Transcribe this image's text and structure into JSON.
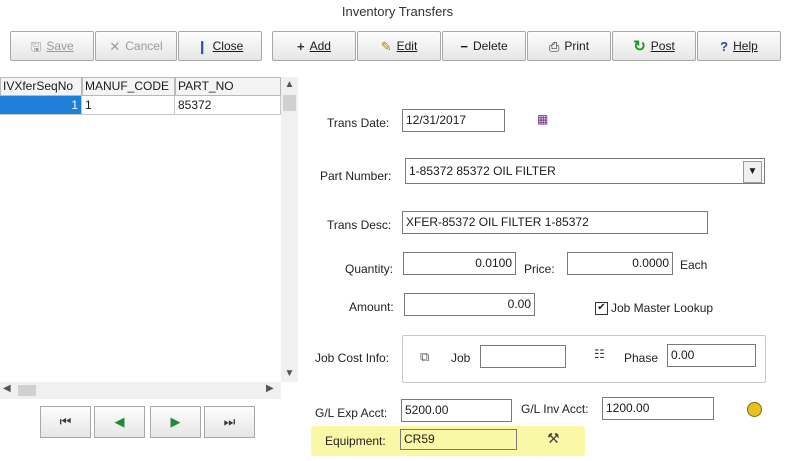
{
  "window": {
    "title": "Inventory Transfers"
  },
  "toolbar": {
    "save": "Save",
    "cancel": "Cancel",
    "close": "Close",
    "add": "Add",
    "edit": "Edit",
    "delete": "Delete",
    "print": "Print",
    "post": "Post",
    "help": "Help"
  },
  "grid": {
    "columns": [
      "IVXferSeqNo",
      "MANUF_CODE",
      "PART_NO"
    ],
    "rows": [
      {
        "seq": "1",
        "manuf": "1",
        "part": "85372"
      }
    ]
  },
  "form": {
    "trans_date_label": "Trans Date:",
    "trans_date": "12/31/2017",
    "part_number_label": "Part Number:",
    "part_number": "1-85372 85372 OIL FILTER",
    "trans_desc_label": "Trans Desc:",
    "trans_desc": "XFER-85372 OIL FILTER 1-85372",
    "quantity_label": "Quantity:",
    "quantity": "0.0100",
    "price_label": "Price:",
    "price": "0.0000",
    "price_unit": "Each",
    "amount_label": "Amount:",
    "amount": "0.00",
    "job_master_label": "Job Master Lookup",
    "job_master_checked": true,
    "job_cost_label": "Job Cost Info:",
    "job_label": "Job",
    "job": "",
    "phase_label": "Phase",
    "phase": "0.00",
    "gl_exp_label": "G/L Exp Acct:",
    "gl_exp": "5200.00",
    "gl_inv_label": "G/L Inv Acct:",
    "gl_inv": "1200.00",
    "equipment_label": "Equipment:",
    "equipment": "CR59"
  },
  "icons": {
    "calendar": "calendar-icon",
    "lookup": "lookup-icon",
    "equipment": "equipment-lookup-icon"
  },
  "colors": {
    "highlight": "#f9f8a7",
    "selected_row": "#1e7fd8",
    "post_icon": "#1b9a2a"
  }
}
